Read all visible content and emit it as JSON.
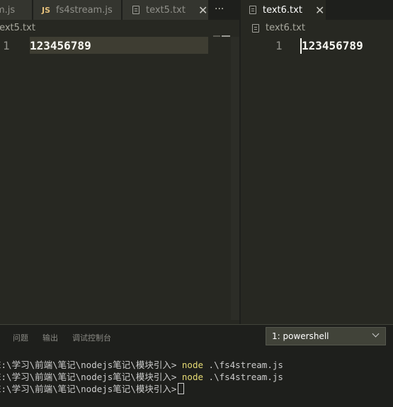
{
  "tabs": [
    {
      "label": "m.js"
    },
    {
      "label": "fs4stream.js",
      "icon": "JS"
    },
    {
      "label": "text5.txt"
    },
    {
      "label": "text6.txt"
    }
  ],
  "more_label": "···",
  "close_glyph": "✕",
  "left_editor": {
    "breadcrumb": "text5.txt",
    "line_number": "1",
    "line_text": "123456789"
  },
  "right_editor": {
    "breadcrumb": "text6.txt",
    "line_number": "1",
    "line_text": "123456789"
  },
  "panel": {
    "tabs": [
      "问题",
      "输出",
      "调试控制台"
    ],
    "shell": "1: powershell"
  },
  "terminal": {
    "prompt": "E:\\学习\\前端\\笔记\\nodejs笔记\\模块引入>",
    "lines": [
      {
        "cmd": "node",
        "arg": " .\\fs4stream.js"
      },
      {
        "cmd": "node",
        "arg": " .\\fs4stream.js"
      }
    ]
  }
}
